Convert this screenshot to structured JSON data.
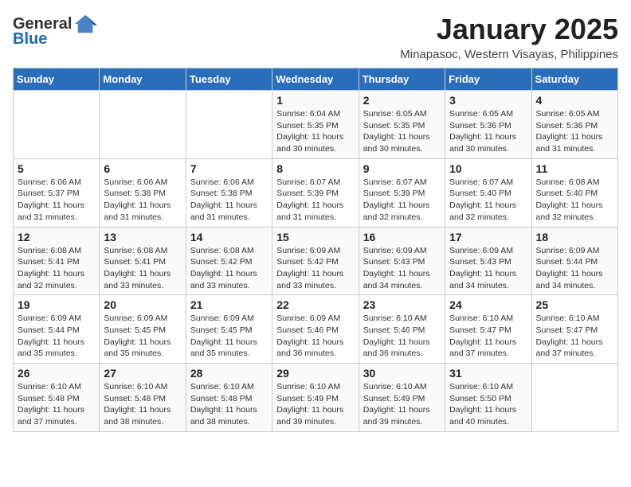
{
  "logo": {
    "general": "General",
    "blue": "Blue"
  },
  "title": "January 2025",
  "location": "Minapasoc, Western Visayas, Philippines",
  "days_header": [
    "Sunday",
    "Monday",
    "Tuesday",
    "Wednesday",
    "Thursday",
    "Friday",
    "Saturday"
  ],
  "weeks": [
    [
      {
        "day": "",
        "info": ""
      },
      {
        "day": "",
        "info": ""
      },
      {
        "day": "",
        "info": ""
      },
      {
        "day": "1",
        "info": "Sunrise: 6:04 AM\nSunset: 5:35 PM\nDaylight: 11 hours and 30 minutes."
      },
      {
        "day": "2",
        "info": "Sunrise: 6:05 AM\nSunset: 5:35 PM\nDaylight: 11 hours and 30 minutes."
      },
      {
        "day": "3",
        "info": "Sunrise: 6:05 AM\nSunset: 5:36 PM\nDaylight: 11 hours and 30 minutes."
      },
      {
        "day": "4",
        "info": "Sunrise: 6:05 AM\nSunset: 5:36 PM\nDaylight: 11 hours and 31 minutes."
      }
    ],
    [
      {
        "day": "5",
        "info": "Sunrise: 6:06 AM\nSunset: 5:37 PM\nDaylight: 11 hours and 31 minutes."
      },
      {
        "day": "6",
        "info": "Sunrise: 6:06 AM\nSunset: 5:38 PM\nDaylight: 11 hours and 31 minutes."
      },
      {
        "day": "7",
        "info": "Sunrise: 6:06 AM\nSunset: 5:38 PM\nDaylight: 11 hours and 31 minutes."
      },
      {
        "day": "8",
        "info": "Sunrise: 6:07 AM\nSunset: 5:39 PM\nDaylight: 11 hours and 31 minutes."
      },
      {
        "day": "9",
        "info": "Sunrise: 6:07 AM\nSunset: 5:39 PM\nDaylight: 11 hours and 32 minutes."
      },
      {
        "day": "10",
        "info": "Sunrise: 6:07 AM\nSunset: 5:40 PM\nDaylight: 11 hours and 32 minutes."
      },
      {
        "day": "11",
        "info": "Sunrise: 6:08 AM\nSunset: 5:40 PM\nDaylight: 11 hours and 32 minutes."
      }
    ],
    [
      {
        "day": "12",
        "info": "Sunrise: 6:08 AM\nSunset: 5:41 PM\nDaylight: 11 hours and 32 minutes."
      },
      {
        "day": "13",
        "info": "Sunrise: 6:08 AM\nSunset: 5:41 PM\nDaylight: 11 hours and 33 minutes."
      },
      {
        "day": "14",
        "info": "Sunrise: 6:08 AM\nSunset: 5:42 PM\nDaylight: 11 hours and 33 minutes."
      },
      {
        "day": "15",
        "info": "Sunrise: 6:09 AM\nSunset: 5:42 PM\nDaylight: 11 hours and 33 minutes."
      },
      {
        "day": "16",
        "info": "Sunrise: 6:09 AM\nSunset: 5:43 PM\nDaylight: 11 hours and 34 minutes."
      },
      {
        "day": "17",
        "info": "Sunrise: 6:09 AM\nSunset: 5:43 PM\nDaylight: 11 hours and 34 minutes."
      },
      {
        "day": "18",
        "info": "Sunrise: 6:09 AM\nSunset: 5:44 PM\nDaylight: 11 hours and 34 minutes."
      }
    ],
    [
      {
        "day": "19",
        "info": "Sunrise: 6:09 AM\nSunset: 5:44 PM\nDaylight: 11 hours and 35 minutes."
      },
      {
        "day": "20",
        "info": "Sunrise: 6:09 AM\nSunset: 5:45 PM\nDaylight: 11 hours and 35 minutes."
      },
      {
        "day": "21",
        "info": "Sunrise: 6:09 AM\nSunset: 5:45 PM\nDaylight: 11 hours and 35 minutes."
      },
      {
        "day": "22",
        "info": "Sunrise: 6:09 AM\nSunset: 5:46 PM\nDaylight: 11 hours and 36 minutes."
      },
      {
        "day": "23",
        "info": "Sunrise: 6:10 AM\nSunset: 5:46 PM\nDaylight: 11 hours and 36 minutes."
      },
      {
        "day": "24",
        "info": "Sunrise: 6:10 AM\nSunset: 5:47 PM\nDaylight: 11 hours and 37 minutes."
      },
      {
        "day": "25",
        "info": "Sunrise: 6:10 AM\nSunset: 5:47 PM\nDaylight: 11 hours and 37 minutes."
      }
    ],
    [
      {
        "day": "26",
        "info": "Sunrise: 6:10 AM\nSunset: 5:48 PM\nDaylight: 11 hours and 37 minutes."
      },
      {
        "day": "27",
        "info": "Sunrise: 6:10 AM\nSunset: 5:48 PM\nDaylight: 11 hours and 38 minutes."
      },
      {
        "day": "28",
        "info": "Sunrise: 6:10 AM\nSunset: 5:48 PM\nDaylight: 11 hours and 38 minutes."
      },
      {
        "day": "29",
        "info": "Sunrise: 6:10 AM\nSunset: 5:49 PM\nDaylight: 11 hours and 39 minutes."
      },
      {
        "day": "30",
        "info": "Sunrise: 6:10 AM\nSunset: 5:49 PM\nDaylight: 11 hours and 39 minutes."
      },
      {
        "day": "31",
        "info": "Sunrise: 6:10 AM\nSunset: 5:50 PM\nDaylight: 11 hours and 40 minutes."
      },
      {
        "day": "",
        "info": ""
      }
    ]
  ]
}
